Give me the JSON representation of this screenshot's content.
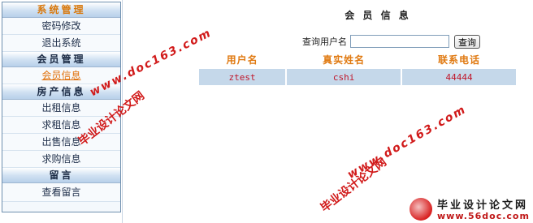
{
  "sidebar": {
    "sections": [
      {
        "title": "系统管理",
        "items": [
          "密码修改",
          "退出系统"
        ]
      },
      {
        "title": "会员管理",
        "items": [
          "会员信息"
        ]
      },
      {
        "title": "房产信息",
        "items": [
          "出租信息",
          "求租信息",
          "出售信息",
          "求购信息"
        ]
      },
      {
        "title": "留言",
        "items": [
          "查看留言"
        ]
      }
    ],
    "active_item": "会员信息"
  },
  "main": {
    "title": "会 员 信 息",
    "search": {
      "label": "查询用户名",
      "value": "",
      "button": "查询"
    },
    "table": {
      "headers": [
        "用户名",
        "真实姓名",
        "联系电话"
      ],
      "rows": [
        [
          "ztest",
          "cshi",
          "44444"
        ]
      ]
    }
  },
  "watermark": {
    "site_cn": "毕业设计论文网",
    "url": "www.doc163.com",
    "logo_cn": "毕业设计论文网",
    "logo_url": "www.56doc.com"
  },
  "colors": {
    "accent": "#e07a12",
    "row_bg": "#c5d8ea",
    "row_text": "#c0162a",
    "watermark": "#d11a1a"
  }
}
